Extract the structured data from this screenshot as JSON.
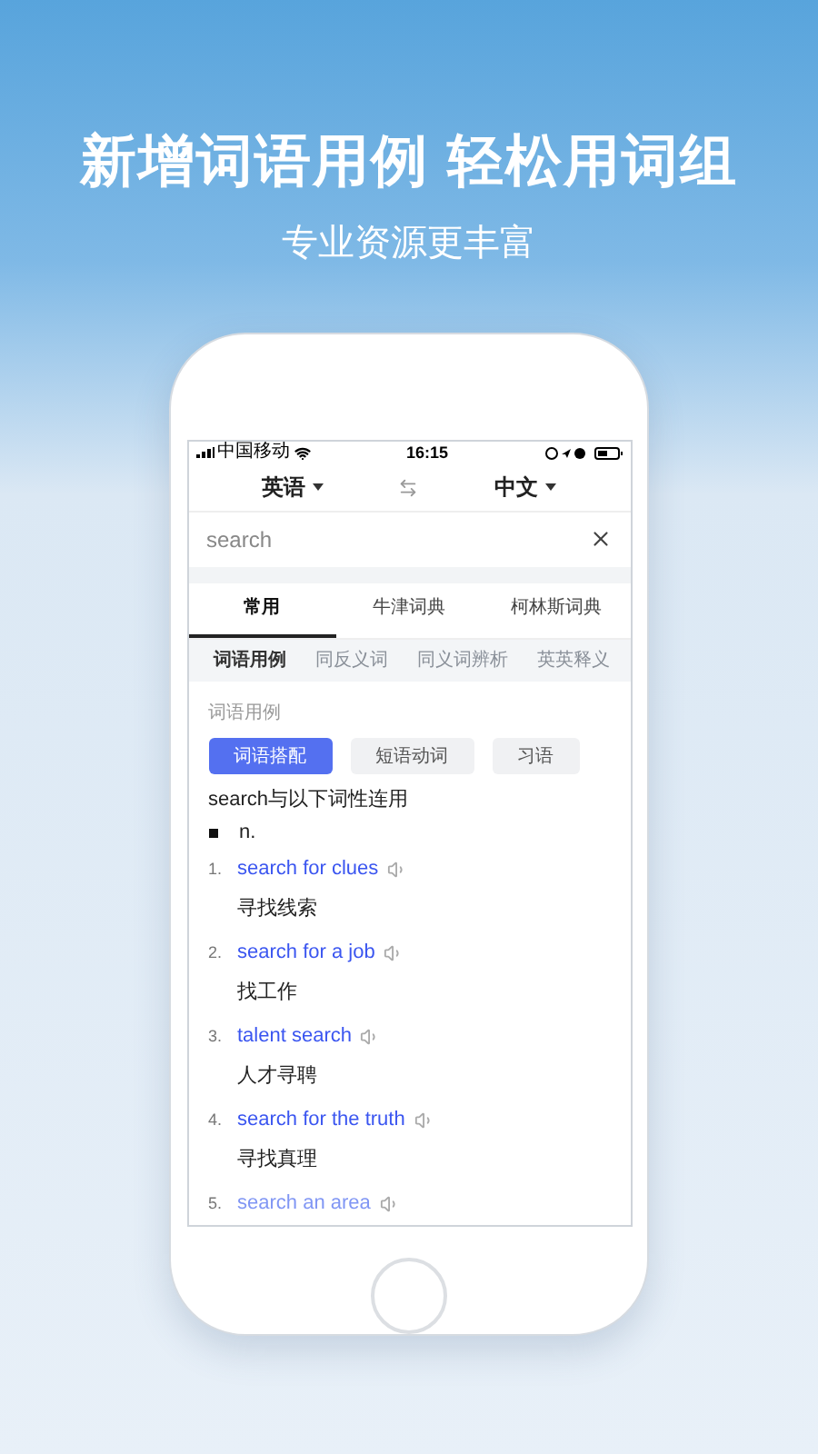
{
  "headline": {
    "title": "新增词语用例 轻松用词组",
    "subtitle": "专业资源更丰富"
  },
  "status_bar": {
    "carrier": "中国移动",
    "time": "16:15"
  },
  "language_bar": {
    "source": "英语",
    "target": "中文"
  },
  "search": {
    "value": "search"
  },
  "tabs": [
    {
      "label": "常用",
      "selected": true
    },
    {
      "label": "牛津词典",
      "selected": false
    },
    {
      "label": "柯林斯词典",
      "selected": false
    }
  ],
  "subtabs": [
    {
      "label": "词语用例",
      "selected": true
    },
    {
      "label": "同反义词",
      "selected": false
    },
    {
      "label": "同义词辨析",
      "selected": false
    },
    {
      "label": "英英释义",
      "selected": false
    }
  ],
  "section_title": "词语用例",
  "chips": [
    {
      "label": "词语搭配",
      "selected": true
    },
    {
      "label": "短语动词",
      "selected": false
    },
    {
      "label": "习语",
      "selected": false
    }
  ],
  "usage_heading": "search与以下词性连用",
  "part_of_speech": "n.",
  "examples": [
    {
      "number": "1.",
      "phrase": "search for clues",
      "translation": "寻找线索",
      "faded": false
    },
    {
      "number": "2.",
      "phrase": "search for a job",
      "translation": "找工作",
      "faded": false
    },
    {
      "number": "3.",
      "phrase": "talent search",
      "translation": "人才寻聘",
      "faded": false
    },
    {
      "number": "4.",
      "phrase": "search for the truth",
      "translation": "寻找真理",
      "faded": false
    },
    {
      "number": "5.",
      "phrase": "search an area",
      "faded": true
    }
  ]
}
